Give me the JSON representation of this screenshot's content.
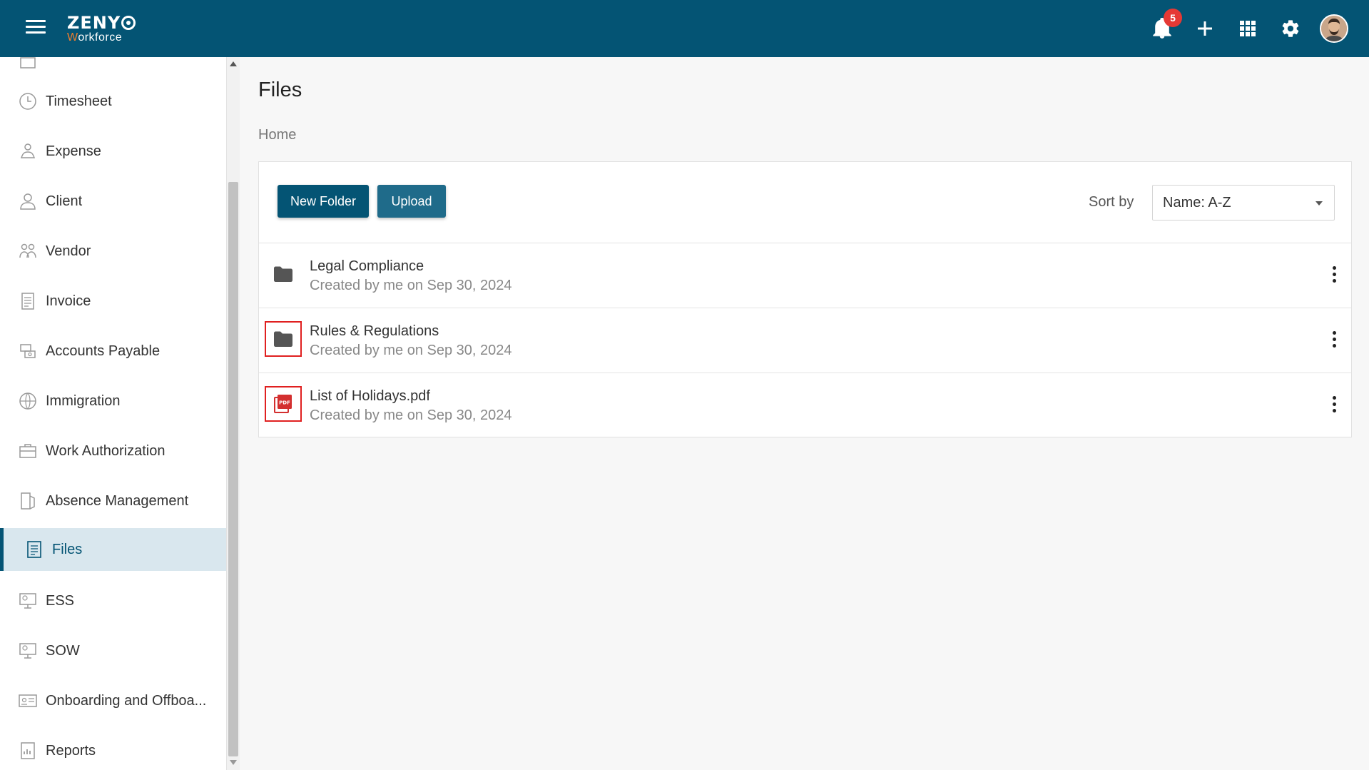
{
  "header": {
    "logo_main": "ZENY",
    "logo_sub_w": "W",
    "logo_sub_rest": "orkforce",
    "notification_count": "5",
    "icons": [
      "menu-icon",
      "bell-icon",
      "plus-icon",
      "apps-grid-icon",
      "gear-icon",
      "avatar"
    ],
    "colors": {
      "bar": "#045474",
      "accent": "#ef7d2d",
      "badge": "#e53935"
    }
  },
  "sidebar": {
    "items": [
      {
        "label": "Timesheet",
        "icon": "clock-icon"
      },
      {
        "label": "Expense",
        "icon": "expense-icon"
      },
      {
        "label": "Client",
        "icon": "user-icon"
      },
      {
        "label": "Vendor",
        "icon": "vendor-icon"
      },
      {
        "label": "Invoice",
        "icon": "invoice-icon"
      },
      {
        "label": "Accounts Payable",
        "icon": "accounts-payable-icon"
      },
      {
        "label": "Immigration",
        "icon": "globe-icon"
      },
      {
        "label": "Work Authorization",
        "icon": "briefcase-icon"
      },
      {
        "label": "Absence Management",
        "icon": "door-icon"
      },
      {
        "label": "Files",
        "icon": "file-icon",
        "active": true
      },
      {
        "label": "ESS",
        "icon": "ess-icon"
      },
      {
        "label": "SOW",
        "icon": "sow-icon"
      },
      {
        "label": "Onboarding and Offboa...",
        "icon": "id-card-icon"
      },
      {
        "label": "Reports",
        "icon": "reports-icon"
      }
    ]
  },
  "main": {
    "title": "Files",
    "breadcrumb": "Home",
    "toolbar": {
      "new_folder_label": "New Folder",
      "upload_label": "Upload",
      "sort_label": "Sort by",
      "sort_value": "Name: A-Z"
    },
    "files": [
      {
        "name": "Legal Compliance",
        "meta": "Created by me on Sep 30, 2024",
        "type": "folder",
        "highlighted": false
      },
      {
        "name": "Rules & Regulations",
        "meta": "Created by me on Sep 30, 2024",
        "type": "folder",
        "highlighted": true
      },
      {
        "name": "List of Holidays.pdf",
        "meta": "Created by me on Sep 30, 2024",
        "type": "pdf",
        "highlighted": true
      }
    ]
  }
}
